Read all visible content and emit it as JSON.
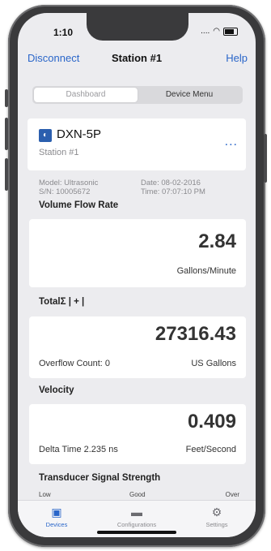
{
  "status_bar": {
    "time": "1:10",
    "signal": "....",
    "wifi": "wifi-icon",
    "battery": "battery-icon"
  },
  "nav": {
    "left_label": "Disconnect",
    "title": "Station #1",
    "right_label": "Help"
  },
  "segment": {
    "tabs": [
      {
        "label": "Dashboard",
        "selected": true
      },
      {
        "label": "Device Menu",
        "selected": false
      }
    ]
  },
  "device": {
    "name": "DXN-5P",
    "station": "Station #1",
    "more_label": "...",
    "model": "Model: Ultrasonic",
    "serial": "S/N: 10005672",
    "date": "Date: 08-02-2016",
    "time": "Time: 07:07:10 PM"
  },
  "volume_flow": {
    "label": "Volume Flow Rate",
    "value": "2.84",
    "unit": "Gallons/Minute"
  },
  "total": {
    "label": "TotalΣ | + |",
    "value": "27316.43",
    "overflow": "Overflow Count: 0",
    "unit": "US Gallons"
  },
  "velocity": {
    "label": "Velocity",
    "value": "0.409",
    "delta_time": "Delta Time  2.235 ns",
    "unit": "Feet/Second"
  },
  "signal": {
    "label": "Transducer Signal Strength",
    "low": "Low",
    "good": "Good",
    "over": "Over"
  },
  "tabbar": {
    "items": [
      {
        "label": "Devices",
        "icon": "devices-icon"
      },
      {
        "label": "Configurations",
        "icon": "folder-icon"
      },
      {
        "label": "Settings",
        "icon": "gear-icon"
      }
    ]
  },
  "colors": {
    "accent": "#2a66c9",
    "background": "#ececef",
    "card": "#ffffff"
  }
}
